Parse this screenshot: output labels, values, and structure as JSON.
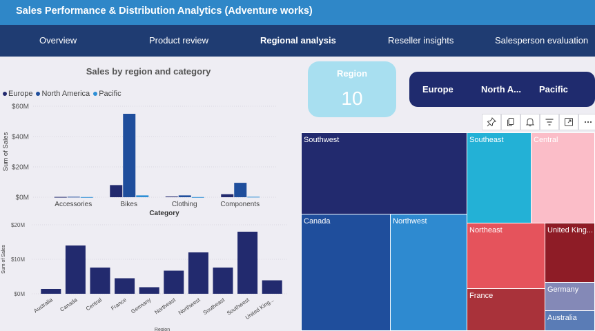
{
  "header": {
    "title": "Sales Performance & Distribution Analytics (Adventure works)"
  },
  "nav": {
    "tabs": [
      {
        "label": "Overview"
      },
      {
        "label": "Product review"
      },
      {
        "label": "Regional analysis",
        "active": true
      },
      {
        "label": "Reseller insights"
      },
      {
        "label": "Salesperson evaluation"
      }
    ]
  },
  "card": {
    "label": "Region",
    "value": "10"
  },
  "slicer": {
    "items": [
      "Europe",
      "North A...",
      "Pacific"
    ]
  },
  "toolbar": {
    "icons": [
      "pin-icon",
      "copy-icon",
      "bell-icon",
      "filter-icon",
      "focus-mode-icon",
      "more-options-icon"
    ]
  },
  "chart_data": [
    {
      "type": "bar",
      "title": "Sales by region and category",
      "xlabel": "Category",
      "ylabel": "Sum of Sales",
      "categories": [
        "Accessories",
        "Bikes",
        "Clothing",
        "Components"
      ],
      "series": [
        {
          "name": "Europe",
          "color": "#222a6e",
          "values": [
            0.2,
            8,
            0.5,
            2
          ]
        },
        {
          "name": "North America",
          "color": "#1f4e9c",
          "values": [
            0.3,
            55,
            1.2,
            9.5
          ]
        },
        {
          "name": "Pacific",
          "color": "#2d8fd6",
          "values": [
            0.1,
            1.2,
            0.1,
            0.3
          ]
        }
      ],
      "yticks": [
        "$0M",
        "$20M",
        "$40M",
        "$60M"
      ],
      "ylim": [
        0,
        60
      ],
      "legend": "top-left"
    },
    {
      "type": "bar",
      "xlabel": "Region",
      "ylabel": "Sum of Sales",
      "categories": [
        "Australia",
        "Canada",
        "Central",
        "France",
        "Germany",
        "Northeast",
        "Northwest",
        "Southeast",
        "Southwest",
        "United King..."
      ],
      "values": [
        1.4,
        14,
        7.6,
        4.5,
        1.9,
        6.7,
        12,
        7.6,
        18,
        3.9
      ],
      "color": "#222a6e",
      "yticks": [
        "$0M",
        "$10M",
        "$20M"
      ],
      "ylim": [
        0,
        20
      ]
    }
  ],
  "treemap": {
    "tiles": [
      {
        "label": "Southwest",
        "color": "#222a6e"
      },
      {
        "label": "Canada",
        "color": "#1f4e9c"
      },
      {
        "label": "Northwest",
        "color": "#2e8ad0"
      },
      {
        "label": "Southeast",
        "color": "#23b1d6"
      },
      {
        "label": "Central",
        "color": "#fbbdc8"
      },
      {
        "label": "Northeast",
        "color": "#e5535c"
      },
      {
        "label": "France",
        "color": "#a9323a"
      },
      {
        "label": "United King...",
        "color": "#8e1c26"
      },
      {
        "label": "Germany",
        "color": "#8489b7"
      },
      {
        "label": "Australia",
        "color": "#5a7cb6"
      }
    ]
  }
}
